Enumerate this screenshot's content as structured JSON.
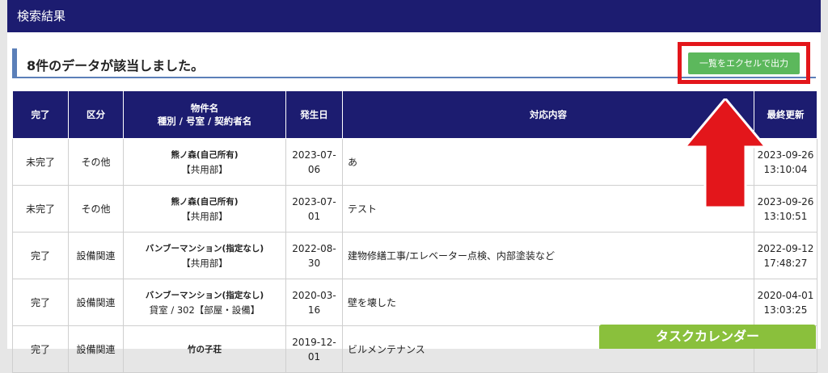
{
  "header": {
    "title": "検索結果"
  },
  "result": {
    "count_text": "8件のデータが該当しました。"
  },
  "toolbar": {
    "export_label": "一覧をエクセルで出力"
  },
  "table": {
    "columns": [
      "完了",
      "区分",
      "物件名",
      "種別 / 号室 / 契約者名",
      "発生日",
      "対応内容",
      "最終更新"
    ],
    "rows": [
      {
        "status": "未完了",
        "category": "その他",
        "property": "熊ノ森(自己所有)",
        "unit": "【共用部】",
        "date": "2023-07-06",
        "content": "あ",
        "updated_date": "2023-09-26",
        "updated_time": "13:10:04"
      },
      {
        "status": "未完了",
        "category": "その他",
        "property": "熊ノ森(自己所有)",
        "unit": "【共用部】",
        "date": "2023-07-01",
        "content": "テスト",
        "updated_date": "2023-09-26",
        "updated_time": "13:10:51"
      },
      {
        "status": "完了",
        "category": "設備関連",
        "property": "バンブーマンション(指定なし)",
        "unit": "【共用部】",
        "date": "2022-08-30",
        "content": "建物修繕工事/エレベーター点検、内部塗装など",
        "updated_date": "2022-09-12",
        "updated_time": "17:48:27"
      },
      {
        "status": "完了",
        "category": "設備関連",
        "property": "バンブーマンション(指定なし)",
        "unit": "貸室 / 302【部屋・設備】",
        "date": "2020-03-16",
        "content": "壁を壊した",
        "updated_date": "2020-04-01",
        "updated_time": "13:03:25"
      },
      {
        "status": "完了",
        "category": "設備関連",
        "property": "竹の子荘",
        "unit": "",
        "date": "2019-12-01",
        "content": "ビルメンテナンス",
        "updated_date": "",
        "updated_time": ""
      }
    ]
  },
  "task_calendar": {
    "label": "タスクカレンダー"
  },
  "colors": {
    "header_bg": "#1c1c70",
    "button_green": "#5cb85c",
    "highlight_red": "#e3161b",
    "calendar_green": "#8ac03c"
  }
}
